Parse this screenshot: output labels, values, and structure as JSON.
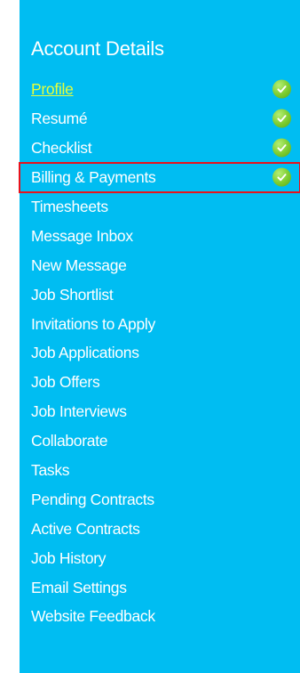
{
  "sidebar": {
    "title": "Account Details",
    "items": [
      {
        "label": "Profile",
        "checked": true,
        "active": true
      },
      {
        "label": "Resumé",
        "checked": true
      },
      {
        "label": "Checklist",
        "checked": true
      },
      {
        "label": "Billing & Payments",
        "checked": true,
        "highlighted": true
      },
      {
        "label": "Timesheets"
      },
      {
        "label": "Message Inbox"
      },
      {
        "label": "New Message"
      },
      {
        "label": "Job Shortlist"
      },
      {
        "label": "Invitations to Apply"
      },
      {
        "label": "Job Applications"
      },
      {
        "label": "Job Offers"
      },
      {
        "label": "Job Interviews"
      },
      {
        "label": "Collaborate"
      },
      {
        "label": "Tasks"
      },
      {
        "label": "Pending Contracts"
      },
      {
        "label": "Active Contracts"
      },
      {
        "label": "Job History"
      },
      {
        "label": "Email Settings"
      },
      {
        "label": "Website Feedback"
      }
    ]
  },
  "colors": {
    "panel_bg": "#00bdf2",
    "active_link": "#e6ff3a",
    "check_green": "#7ccc2e",
    "highlight_border": "#e8121c"
  },
  "icons": {
    "check": "check-circle-icon"
  }
}
